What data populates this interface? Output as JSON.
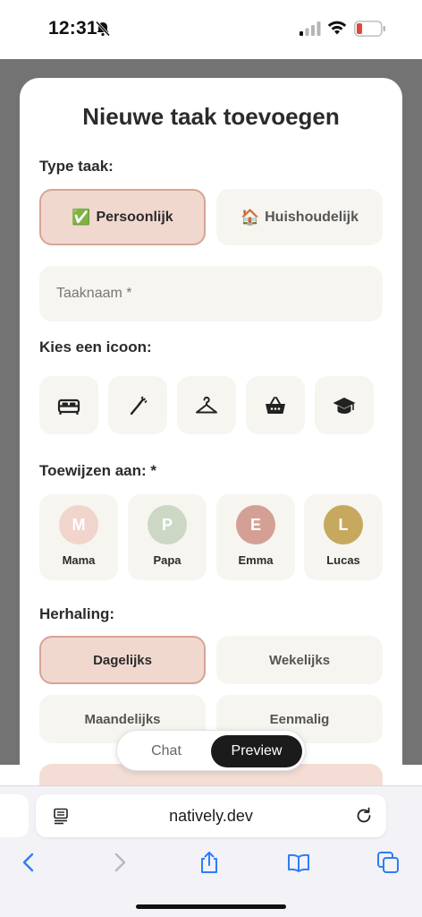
{
  "status_bar": {
    "time": "12:31",
    "battery_color": "#e5453b"
  },
  "modal": {
    "title": "Nieuwe taak toevoegen",
    "type_label": "Type taak:",
    "task_types": [
      {
        "emoji": "✅",
        "label": "Persoonlijk",
        "selected": true
      },
      {
        "emoji": "🏠",
        "label": "Huishoudelijk",
        "selected": false
      }
    ],
    "name_input": {
      "placeholder": "Taaknaam *",
      "value": ""
    },
    "icon_label": "Kies een icoon:",
    "icons": [
      "bed-icon",
      "toothbrush-icon",
      "hanger-icon",
      "basket-icon",
      "graduation-cap-icon"
    ],
    "assign_label": "Toewijzen aan: *",
    "people": [
      {
        "initial": "M",
        "name": "Mama",
        "color": "#f1d4cb"
      },
      {
        "initial": "P",
        "name": "Papa",
        "color": "#ccd8c4"
      },
      {
        "initial": "E",
        "name": "Emma",
        "color": "#d4a096"
      },
      {
        "initial": "L",
        "name": "Lucas",
        "color": "#c7a85f"
      }
    ],
    "repeat_label": "Herhaling:",
    "repeat_options": [
      {
        "label": "Dagelijks",
        "selected": true
      },
      {
        "label": "Wekelijks",
        "selected": false
      },
      {
        "label": "Maandelijks",
        "selected": false
      },
      {
        "label": "Eenmalig",
        "selected": false
      }
    ]
  },
  "toggle": {
    "chat_label": "Chat",
    "preview_label": "Preview",
    "active": "Preview"
  },
  "browser": {
    "url": "natively.dev"
  },
  "colors": {
    "accent_selected_bg": "#f1d8cf",
    "accent_selected_border": "#d7a496",
    "tile_bg": "#f6f5f0",
    "ios_blue": "#2f7cf6"
  }
}
